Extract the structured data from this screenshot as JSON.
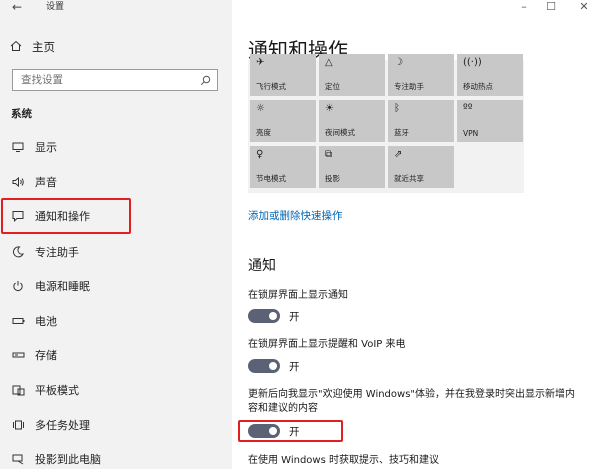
{
  "window": {
    "title": "设置",
    "back": "←",
    "minimize": "–",
    "maximize": "☐",
    "close": "✕"
  },
  "sidebar": {
    "home_label": "主页",
    "search_placeholder": "查找设置",
    "section_label": "系统",
    "items": [
      {
        "label": "显示",
        "icon": "monitor-icon"
      },
      {
        "label": "声音",
        "icon": "speaker-icon"
      },
      {
        "label": "通知和操作",
        "icon": "notification-icon",
        "selected": true
      },
      {
        "label": "专注助手",
        "icon": "moon-icon"
      },
      {
        "label": "电源和睡眠",
        "icon": "power-icon"
      },
      {
        "label": "电池",
        "icon": "battery-icon"
      },
      {
        "label": "存储",
        "icon": "storage-icon"
      },
      {
        "label": "平板模式",
        "icon": "tablet-icon"
      },
      {
        "label": "多任务处理",
        "icon": "multitask-icon"
      },
      {
        "label": "投影到此电脑",
        "icon": "project-icon"
      }
    ]
  },
  "main": {
    "title": "通知和操作",
    "quick_actions": [
      {
        "label": "飞行模式",
        "icon": "airplane-icon",
        "glyph": "✈"
      },
      {
        "label": "定位",
        "icon": "location-icon",
        "glyph": "△"
      },
      {
        "label": "专注助手",
        "icon": "moon-icon",
        "glyph": "☽"
      },
      {
        "label": "移动热点",
        "icon": "hotspot-icon",
        "glyph": "((·))"
      },
      {
        "label": "亮度",
        "icon": "brightness-icon",
        "glyph": "☼"
      },
      {
        "label": "夜间模式",
        "icon": "night-light-icon",
        "glyph": "☀"
      },
      {
        "label": "蓝牙",
        "icon": "bluetooth-icon",
        "glyph": "ᛒ"
      },
      {
        "label": "VPN",
        "icon": "vpn-icon",
        "glyph": "ºº"
      },
      {
        "label": "节电模式",
        "icon": "battery-saver-icon",
        "glyph": "♀"
      },
      {
        "label": "投影",
        "icon": "project-icon",
        "glyph": "⧉"
      },
      {
        "label": "就近共享",
        "icon": "share-icon",
        "glyph": "⇗"
      }
    ],
    "edit_link": "添加或删除快速操作",
    "notifications_heading": "通知",
    "settings": [
      {
        "label": "在锁屏界面上显示通知",
        "state": "开"
      },
      {
        "label": "在锁屏界面上显示提醒和 VoIP 来电",
        "state": "开"
      },
      {
        "label": "更新后向我显示\"欢迎使用 Windows\"体验，并在我登录时突出显示新增内容和建议的内容",
        "state": "开"
      }
    ],
    "next_setting_label": "在使用 Windows 时获取提示、技巧和建议"
  },
  "colors": {
    "accent_link": "#0066b4",
    "toggle_on": "#5b6275",
    "highlight": "#e02020"
  }
}
